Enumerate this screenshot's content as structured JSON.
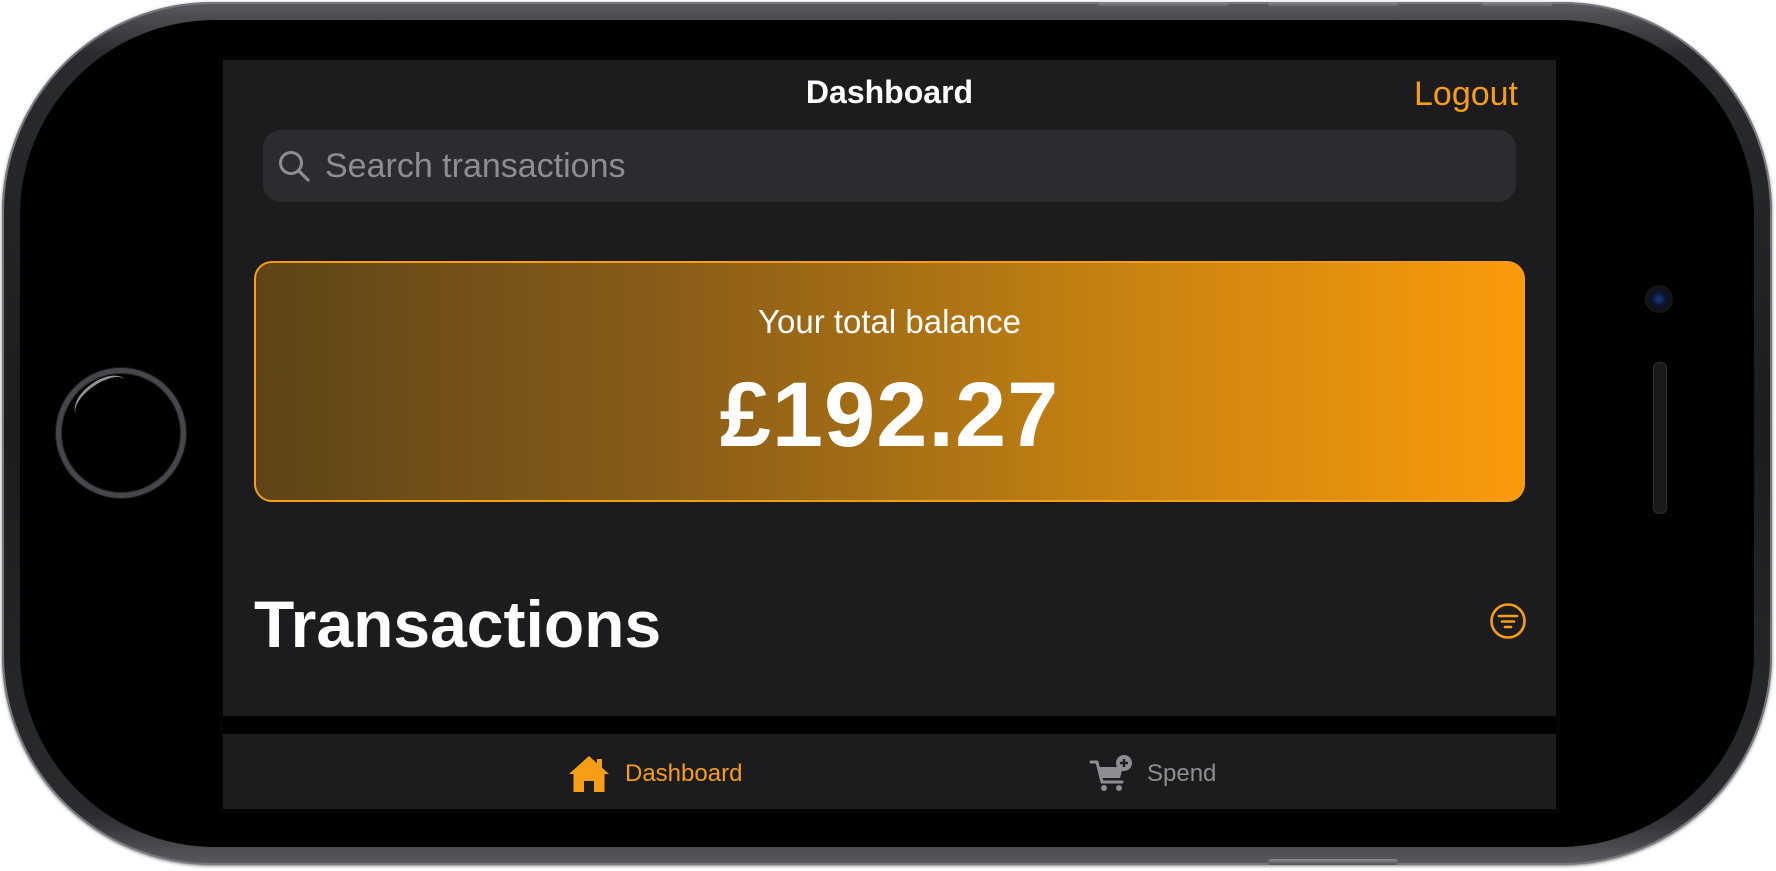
{
  "nav": {
    "title": "Dashboard",
    "logout_label": "Logout"
  },
  "search": {
    "placeholder": "Search transactions"
  },
  "balance": {
    "label": "Your total balance",
    "amount": "£192.27"
  },
  "transactions": {
    "title": "Transactions"
  },
  "tabs": [
    {
      "label": "Dashboard",
      "icon": "home-icon",
      "selected": true
    },
    {
      "label": "Spend",
      "icon": "cart-add-icon",
      "selected": false
    }
  ],
  "colors": {
    "accent": "#f79d16",
    "background": "#1c1c1e",
    "search_field": "#2c2c30",
    "inactive_tab": "#8d8d93"
  }
}
